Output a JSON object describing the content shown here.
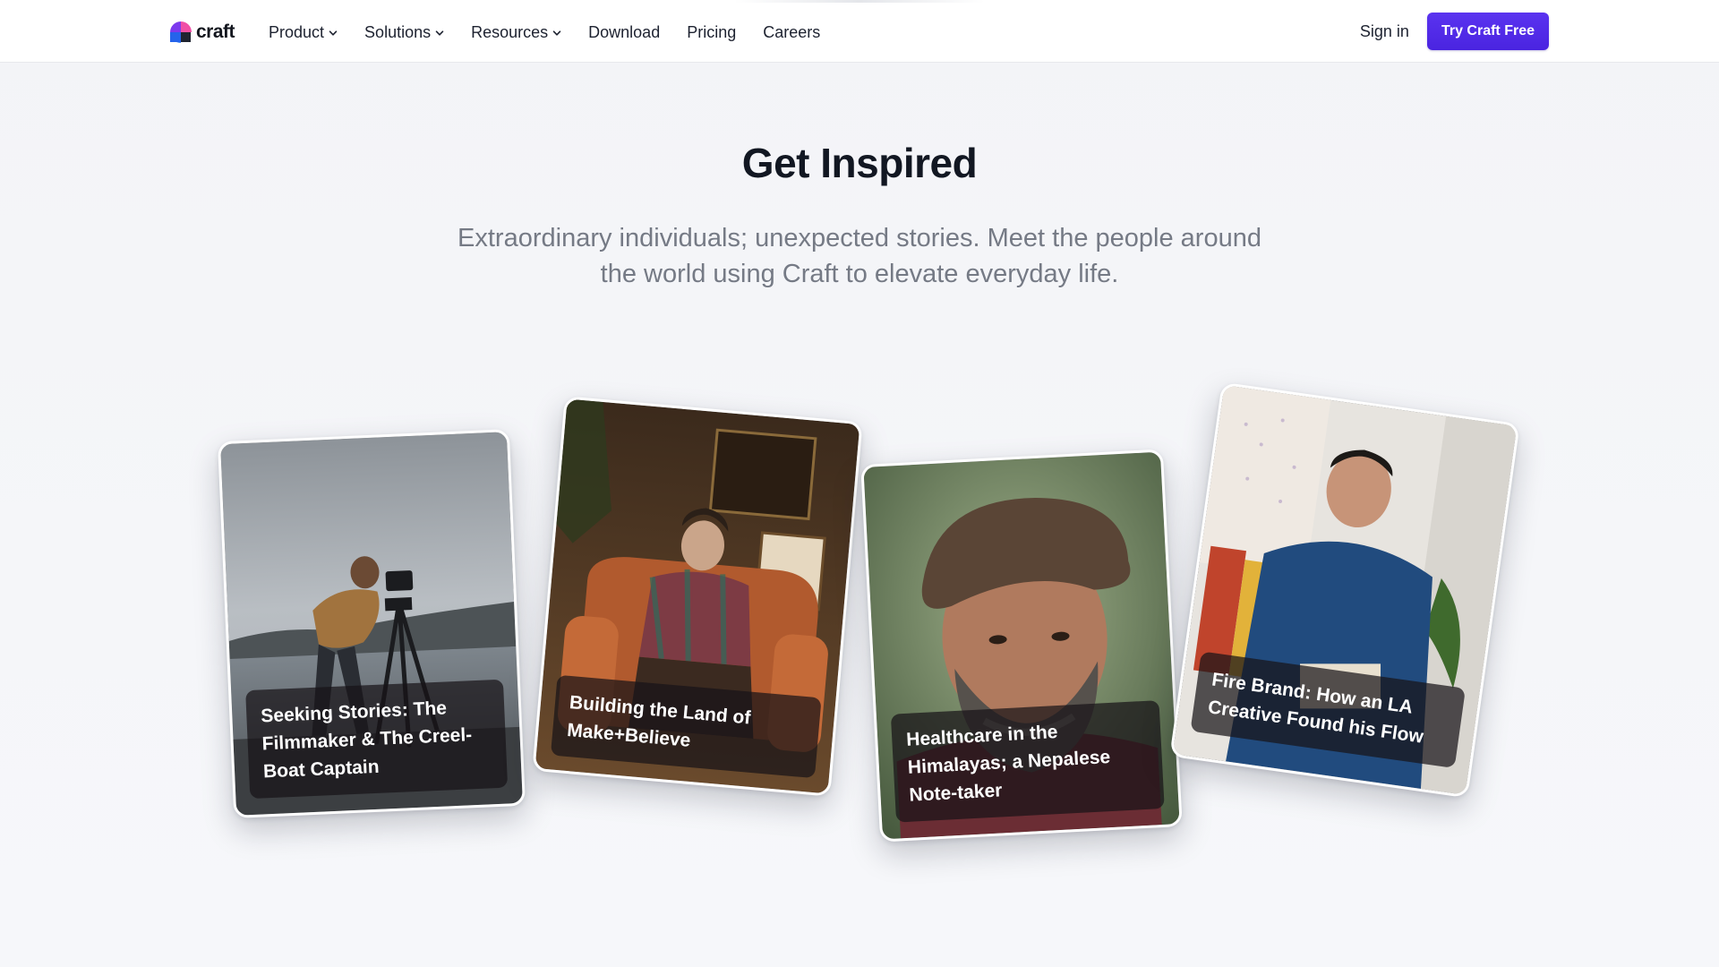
{
  "nav": {
    "logo_text": "craft",
    "items": [
      {
        "label": "Product",
        "has_dropdown": true
      },
      {
        "label": "Solutions",
        "has_dropdown": true
      },
      {
        "label": "Resources",
        "has_dropdown": true
      },
      {
        "label": "Download",
        "has_dropdown": false
      },
      {
        "label": "Pricing",
        "has_dropdown": false
      },
      {
        "label": "Careers",
        "has_dropdown": false
      }
    ],
    "sign_in_label": "Sign in",
    "cta_label": "Try Craft Free",
    "cta_color": "#4f2be8"
  },
  "hero": {
    "title": "Get Inspired",
    "subtitle": "Extraordinary individuals; unexpected stories. Meet the people around the world using Craft to elevate everyday life."
  },
  "stories": [
    {
      "caption": "Seeking Stories: The Filmmaker & The Creel-Boat Captain",
      "image": "filmmaker-with-camera-on-tripod-by-sea"
    },
    {
      "caption": "Building the Land of Make+Believe",
      "image": "woman-seated-in-orange-armchair"
    },
    {
      "caption": "Healthcare in the Himalayas; a Nepalese Note-taker",
      "image": "bearded-man-in-flat-cap-portrait"
    },
    {
      "caption": "Fire Brand: How an LA Creative Found his Flow",
      "image": "man-in-blue-shirt-reading-book"
    }
  ]
}
